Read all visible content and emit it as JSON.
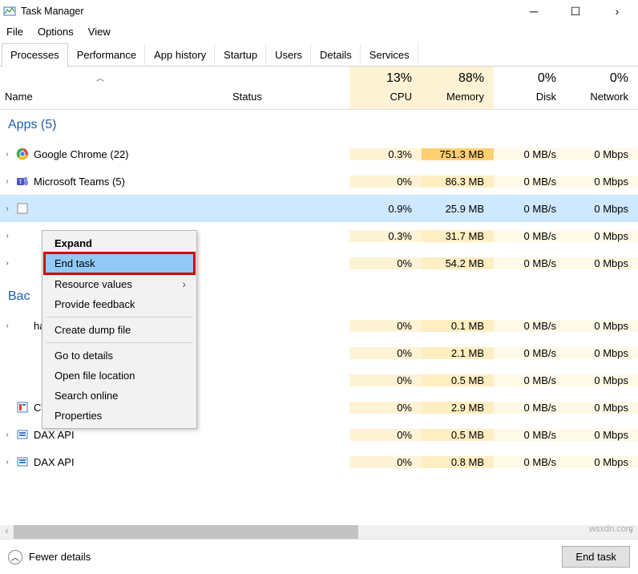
{
  "window": {
    "title": "Task Manager"
  },
  "menu": {
    "file": "File",
    "options": "Options",
    "view": "View"
  },
  "tabs": [
    "Processes",
    "Performance",
    "App history",
    "Startup",
    "Users",
    "Details",
    "Services"
  ],
  "active_tab": 0,
  "columns": {
    "name": "Name",
    "status": "Status",
    "cpu": {
      "pct": "13%",
      "label": "CPU"
    },
    "memory": {
      "pct": "88%",
      "label": "Memory"
    },
    "disk": {
      "pct": "0%",
      "label": "Disk"
    },
    "network": {
      "pct": "0%",
      "label": "Network"
    }
  },
  "groups": {
    "apps": "Apps (5)",
    "background": "Bac"
  },
  "rows": [
    {
      "name": "Google Chrome (22)",
      "cpu": "0.3%",
      "mem": "751.3 MB",
      "disk": "0 MB/s",
      "net": "0 Mbps",
      "icon": "chrome",
      "memhot": true
    },
    {
      "name": "Microsoft Teams (5)",
      "cpu": "0%",
      "mem": "86.3 MB",
      "disk": "0 MB/s",
      "net": "0 Mbps",
      "icon": "teams"
    },
    {
      "name": "",
      "cpu": "0.9%",
      "mem": "25.9 MB",
      "disk": "0 MB/s",
      "net": "0 Mbps",
      "icon": "blank",
      "selected": true
    },
    {
      "name": "",
      "cpu": "0.3%",
      "mem": "31.7 MB",
      "disk": "0 MB/s",
      "net": "0 Mbps",
      "icon": "blank"
    },
    {
      "name": "",
      "cpu": "0%",
      "mem": "54.2 MB",
      "disk": "0 MB/s",
      "net": "0 Mbps",
      "icon": "blank"
    }
  ],
  "bg_partial": "han...",
  "bg_rows": [
    {
      "name": "",
      "cpu": "0%",
      "mem": "0.1 MB",
      "disk": "0 MB/s",
      "net": "0 Mbps",
      "icon": "svc"
    },
    {
      "name": "",
      "cpu": "0%",
      "mem": "2.1 MB",
      "disk": "0 MB/s",
      "net": "0 Mbps",
      "icon": "svc"
    },
    {
      "name": "",
      "cpu": "0%",
      "mem": "0.5 MB",
      "disk": "0 MB/s",
      "net": "0 Mbps",
      "icon": "svc"
    },
    {
      "name": "CTF Loader",
      "cpu": "0%",
      "mem": "2.9 MB",
      "disk": "0 MB/s",
      "net": "0 Mbps",
      "icon": "ctf"
    },
    {
      "name": "DAX API",
      "cpu": "0%",
      "mem": "0.5 MB",
      "disk": "0 MB/s",
      "net": "0 Mbps",
      "icon": "dax"
    },
    {
      "name": "DAX API",
      "cpu": "0%",
      "mem": "0.8 MB",
      "disk": "0 MB/s",
      "net": "0 Mbps",
      "icon": "dax"
    }
  ],
  "context_menu": {
    "expand": "Expand",
    "end_task": "End task",
    "resource_values": "Resource values",
    "provide_feedback": "Provide feedback",
    "create_dump": "Create dump file",
    "go_to_details": "Go to details",
    "open_file_location": "Open file location",
    "search_online": "Search online",
    "properties": "Properties"
  },
  "footer": {
    "fewer": "Fewer details",
    "end_task": "End task"
  },
  "watermark": "wsxdn.com"
}
